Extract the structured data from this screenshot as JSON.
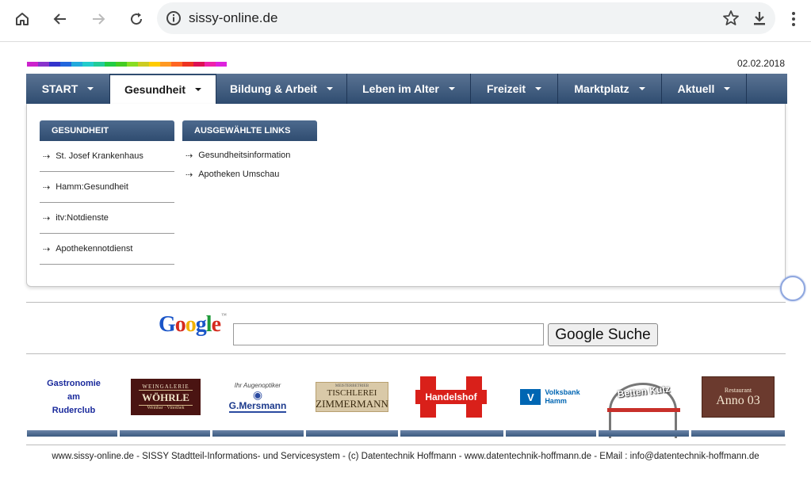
{
  "browser": {
    "url": "sissy-online.de"
  },
  "header": {
    "date": "02.02.2018",
    "rainbow_colors": [
      "#cc22cc",
      "#8833cc",
      "#3333cc",
      "#2266dd",
      "#22aadd",
      "#22cccc",
      "#22cc99",
      "#22cc44",
      "#44cc22",
      "#88dd22",
      "#cccc22",
      "#ffcc00",
      "#ff9922",
      "#ff6622",
      "#ee3322",
      "#dd1155",
      "#ee22aa",
      "#dd22dd"
    ]
  },
  "nav": {
    "items": [
      {
        "label": "START",
        "width": 106
      },
      {
        "label": "Gesundheit",
        "width": 134,
        "active": true
      },
      {
        "label": "Bildung & Arbeit",
        "width": 165
      },
      {
        "label": "Leben im Alter",
        "width": 156
      },
      {
        "label": "Freizeit",
        "width": 110
      },
      {
        "label": "Marktplatz",
        "width": 131
      },
      {
        "label": "Aktuell",
        "width": 107
      }
    ]
  },
  "dropdown": {
    "col1": {
      "heading": "GESUNDHEIT",
      "items": [
        "St. Josef Krankenhaus",
        "Hamm:Gesundheit",
        "itv:Notdienste",
        "Apothekennotdienst"
      ]
    },
    "col2": {
      "heading": "AUSGEWÄHLTE LINKS",
      "items": [
        "Gesundheitsinformation",
        "Apotheken Umschau"
      ]
    }
  },
  "search": {
    "logo_text": "Google",
    "logo_tm": "™",
    "button_label": "Google Suche",
    "input_value": ""
  },
  "sponsors": {
    "gastro": [
      "Gastronomie",
      "am",
      "Ruderclub"
    ],
    "wein": {
      "top": "WEINGALERIE",
      "name": "WÖHRLE",
      "sub": "Weinbar · Vinothek"
    },
    "mers": {
      "top": "Ihr Augenoptiker",
      "name": "G.Mersmann"
    },
    "tisch": {
      "top": "MEISTERBETRIEB",
      "name1": "TISCHLEREI",
      "name2": "ZIMMERMANN"
    },
    "handel": "Handelshof",
    "volks": {
      "line1": "Volksbank",
      "line2": "Hamm"
    },
    "betten": "Betten Kutz",
    "anno": {
      "top": "Restaurant",
      "name": "Anno 03"
    }
  },
  "footer": {
    "text": "www.sissy-online.de - SISSY Stadtteil-Informations- und Servicesystem - (c) Datentechnik Hoffmann - www.datentechnik-hoffmann.de - EMail : info@datentechnik-hoffmann.de"
  }
}
